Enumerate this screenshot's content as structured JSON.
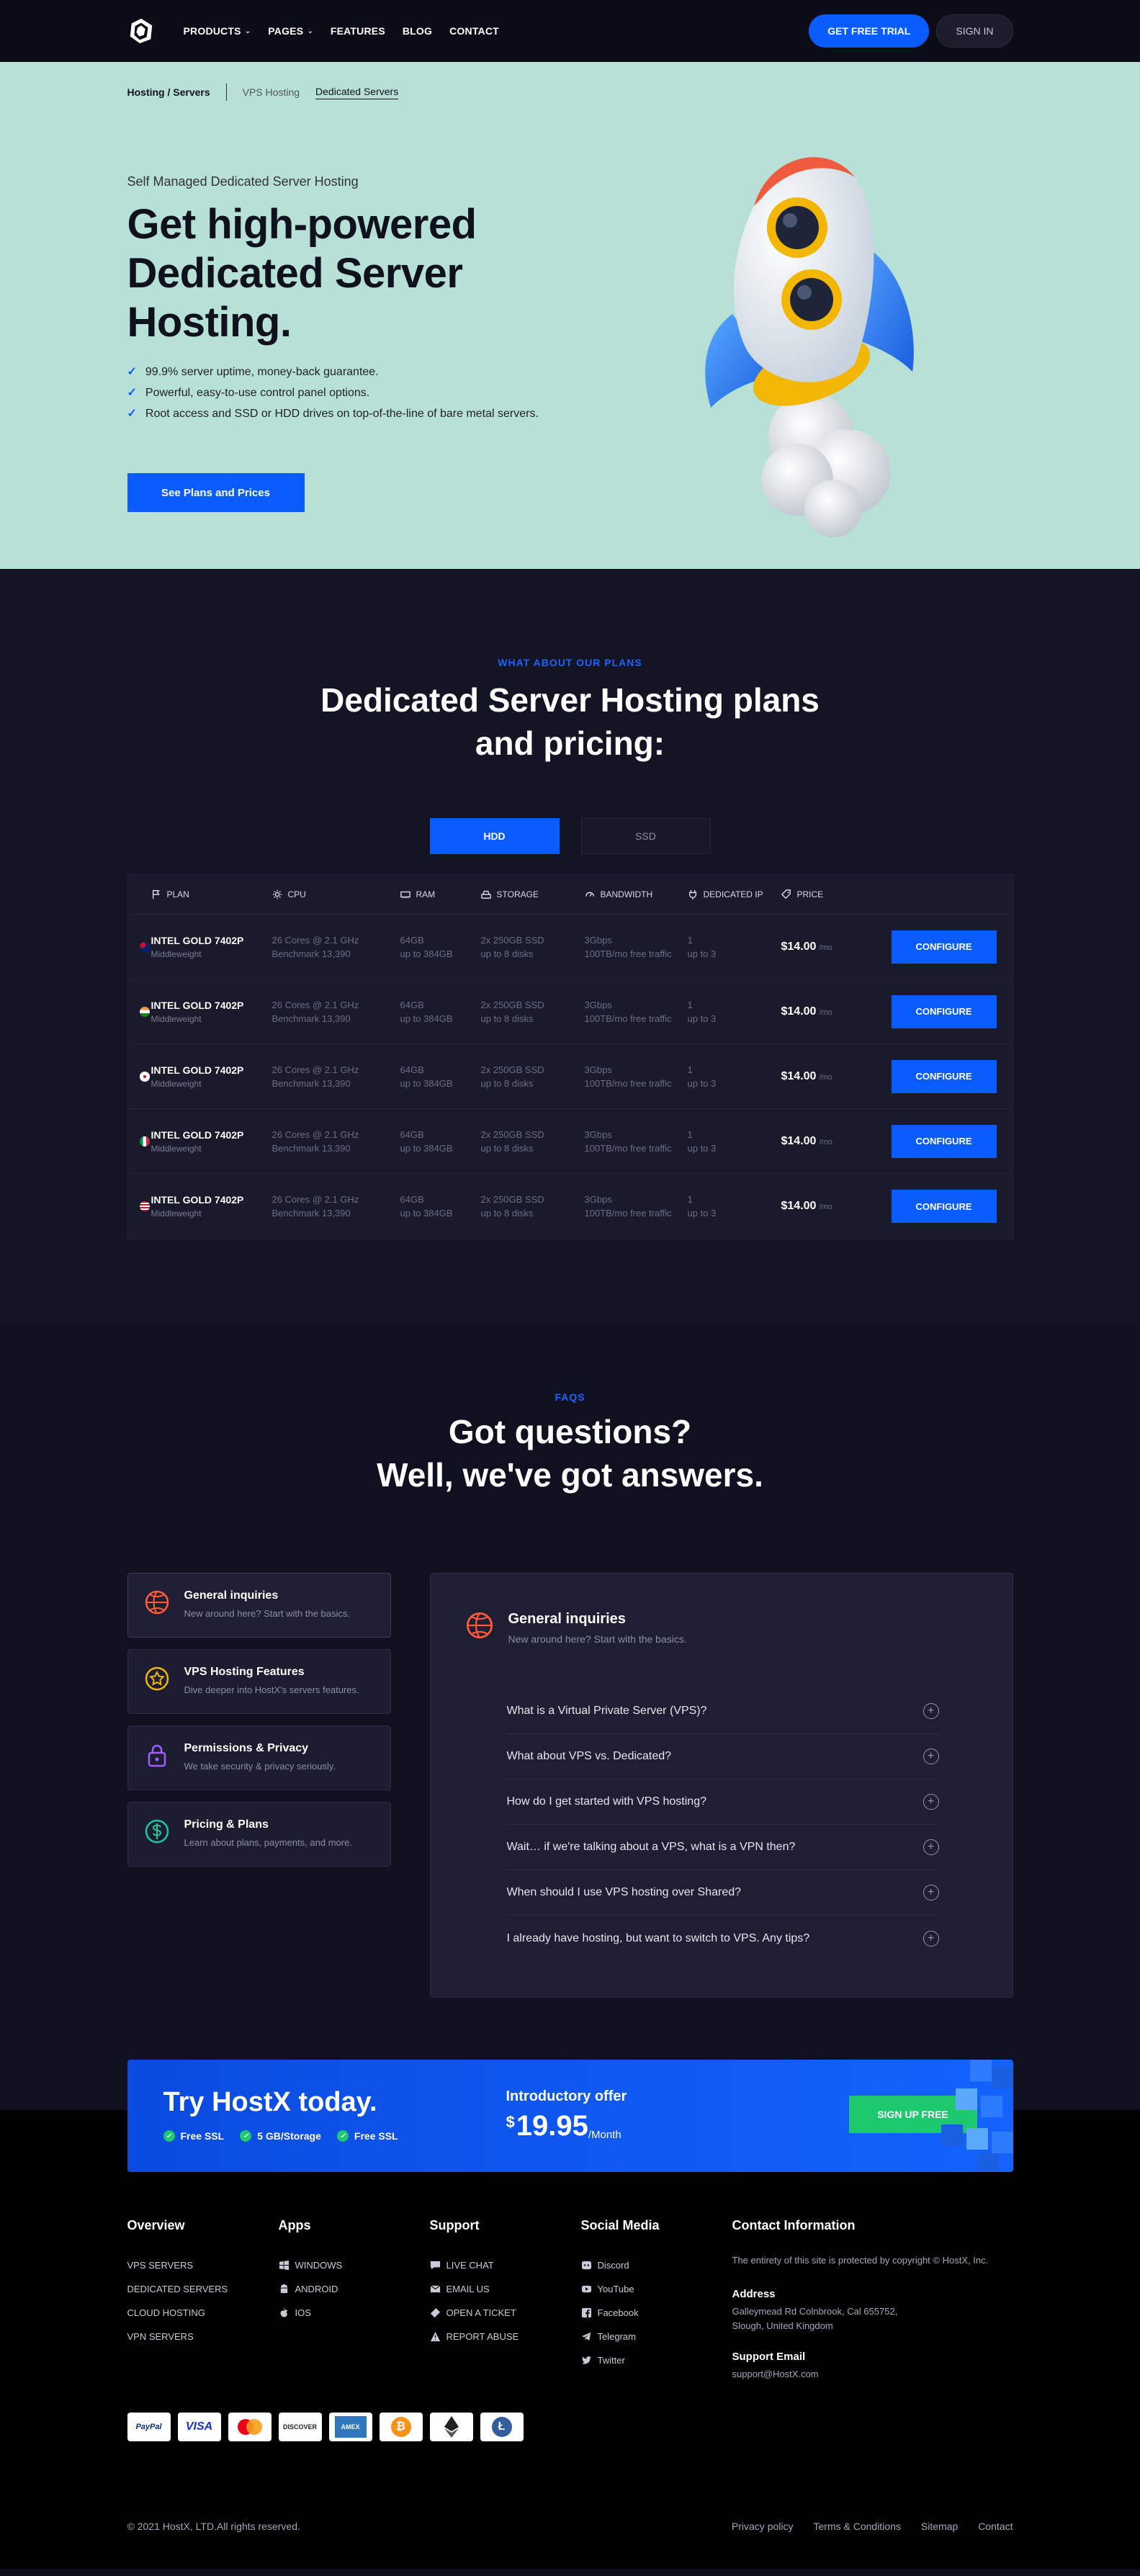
{
  "nav": {
    "items": [
      "PRODUCTS",
      "PAGES",
      "FEATURES",
      "BLOG",
      "CONTACT"
    ],
    "trial": "GET FREE TRIAL",
    "signin": "SIGN IN"
  },
  "hero": {
    "crumb_main": "Hosting / Servers",
    "crumb_vps": "VPS Hosting",
    "crumb_dedicated": "Dedicated Servers",
    "subtitle": "Self Managed Dedicated Server Hosting",
    "title": "Get high-powered Dedicated Server Hosting.",
    "checks": [
      "99.9% server uptime, money-back guarantee.",
      "Powerful, easy-to-use control panel options.",
      "Root access and SSD or HDD drives on top-of-the-line of bare metal servers."
    ],
    "cta": "See Plans and Prices"
  },
  "plans": {
    "eyebrow": "WHAT ABOUT OUR PLANS",
    "title_line1": "Dedicated Server Hosting plans",
    "title_line2": "and pricing:",
    "tab_hdd": "HDD",
    "tab_ssd": "SSD",
    "headers": [
      "PLAN",
      "CPU",
      "RAM",
      "STORAGE",
      "BANDWIDTH",
      "DEDICATED IP",
      "PRICE"
    ],
    "rows": [
      {
        "flag": "au",
        "name": "INTEL GOLD 7402P",
        "tier": "Middleweight",
        "cpu": "26 Cores @ 2.1 GHz",
        "bench": "Benchmark 13,390",
        "ram": "64GB",
        "ram2": "up to 384GB",
        "storage": "2x 250GB SSD",
        "storage2": "up to 8 disks",
        "bw": "3Gbps",
        "bw2": "100TB/mo free traffic",
        "ip": "1",
        "ip2": "up to 3",
        "price": "$14.00",
        "per": "/mo",
        "btn": "CONFIGURE"
      },
      {
        "flag": "in",
        "name": "INTEL GOLD 7402P",
        "tier": "Middleweight",
        "cpu": "26 Cores @ 2.1 GHz",
        "bench": "Benchmark 13,390",
        "ram": "64GB",
        "ram2": "up to 384GB",
        "storage": "2x 250GB SSD",
        "storage2": "up to 8 disks",
        "bw": "3Gbps",
        "bw2": "100TB/mo free traffic",
        "ip": "1",
        "ip2": "up to 3",
        "price": "$14.00",
        "per": "/mo",
        "btn": "CONFIGURE"
      },
      {
        "flag": "gb",
        "name": "INTEL GOLD 7402P",
        "tier": "Middleweight",
        "cpu": "26 Cores @ 2.1 GHz",
        "bench": "Benchmark 13,390",
        "ram": "64GB",
        "ram2": "up to 384GB",
        "storage": "2x 250GB SSD",
        "storage2": "up to 8 disks",
        "bw": "3Gbps",
        "bw2": "100TB/mo free traffic",
        "ip": "1",
        "ip2": "up to 3",
        "price": "$14.00",
        "per": "/mo",
        "btn": "CONFIGURE"
      },
      {
        "flag": "it",
        "name": "INTEL GOLD 7402P",
        "tier": "Middleweight",
        "cpu": "26 Cores @ 2.1 GHz",
        "bench": "Benchmark 13,390",
        "ram": "64GB",
        "ram2": "up to 384GB",
        "storage": "2x 250GB SSD",
        "storage2": "up to 8 disks",
        "bw": "3Gbps",
        "bw2": "100TB/mo free traffic",
        "ip": "1",
        "ip2": "up to 3",
        "price": "$14.00",
        "per": "/mo",
        "btn": "CONFIGURE"
      },
      {
        "flag": "us",
        "name": "INTEL GOLD 7402P",
        "tier": "Middleweight",
        "cpu": "26 Cores @ 2.1 GHz",
        "bench": "Benchmark 13,390",
        "ram": "64GB",
        "ram2": "up to 384GB",
        "storage": "2x 250GB SSD",
        "storage2": "up to 8 disks",
        "bw": "3Gbps",
        "bw2": "100TB/mo free traffic",
        "ip": "1",
        "ip2": "up to 3",
        "price": "$14.00",
        "per": "/mo",
        "btn": "CONFIGURE"
      }
    ]
  },
  "faq": {
    "eyebrow": "FAQS",
    "title_line1": "Got questions?",
    "title_line2": "Well, we've got answers.",
    "categories": [
      {
        "title": "General inquiries",
        "desc": "New around here? Start with the basics.",
        "icon": "basketball-icon",
        "color": "#ff5a3c"
      },
      {
        "title": "VPS Hosting Features",
        "desc": "Dive deeper into HostX's servers features.",
        "icon": "star-badge-icon",
        "color": "#f2b705"
      },
      {
        "title": "Permissions & Privacy",
        "desc": "We take security & privacy seriously.",
        "icon": "lock-icon",
        "color": "#a35cff"
      },
      {
        "title": "Pricing & Plans",
        "desc": "Learn about plans, payments, and more.",
        "icon": "dollar-icon",
        "color": "#1ec8a0"
      }
    ],
    "panel_title": "General inquiries",
    "panel_desc": "New around here? Start with the basics.",
    "questions": [
      "What is a Virtual Private Server (VPS)?",
      "What about VPS vs. Dedicated?",
      "How do I get started with VPS hosting?",
      "Wait… if we're talking about a VPS, what is a VPN then?",
      "When should I use VPS hosting over Shared?",
      "I already have hosting, but want to switch to VPS. Any tips?"
    ]
  },
  "promo": {
    "title": "Try HostX today.",
    "features": [
      "Free SSL",
      "5 GB/Storage",
      "Free SSL"
    ],
    "offer_label": "Introductory offer",
    "currency": "$",
    "amount": "19.95",
    "period": "/Month",
    "cta": "SIGN UP FREE"
  },
  "footer": {
    "overview_h": "Overview",
    "overview": [
      "VPS SERVERS",
      "DEDICATED SERVERS",
      "CLOUD HOSTING",
      "VPN SERVERS"
    ],
    "apps_h": "Apps",
    "apps": [
      "WINDOWS",
      "ANDROID",
      "IOS"
    ],
    "support_h": "Support",
    "support": [
      "LIVE CHAT",
      "EMAIL US",
      "OPEN A TICKET",
      "REPORT ABUSE"
    ],
    "social_h": "Social Media",
    "social": [
      "Discord",
      "YouTube",
      "Facebook",
      "Telegram",
      "Twitter"
    ],
    "contact_h": "Contact Information",
    "copyright_note": "The entirety of this site is protected by copyright © HostX, Inc.",
    "address_h": "Address",
    "address": "Galleymead Rd Colnbrook, Cal 655752, Slough, United Kingdom",
    "email_h": "Support Email",
    "email": "support@HostX.com",
    "payments": [
      "PayPal",
      "VISA",
      "mastercard",
      "DISCOVER",
      "AMEX",
      "bitcoin",
      "ethereum",
      "litecoin"
    ],
    "copyright": "© 2021 HostX, LTD.All rights reserved.",
    "links": [
      "Privacy policy",
      "Terms & Conditions",
      "Sitemap",
      "Contact"
    ]
  }
}
